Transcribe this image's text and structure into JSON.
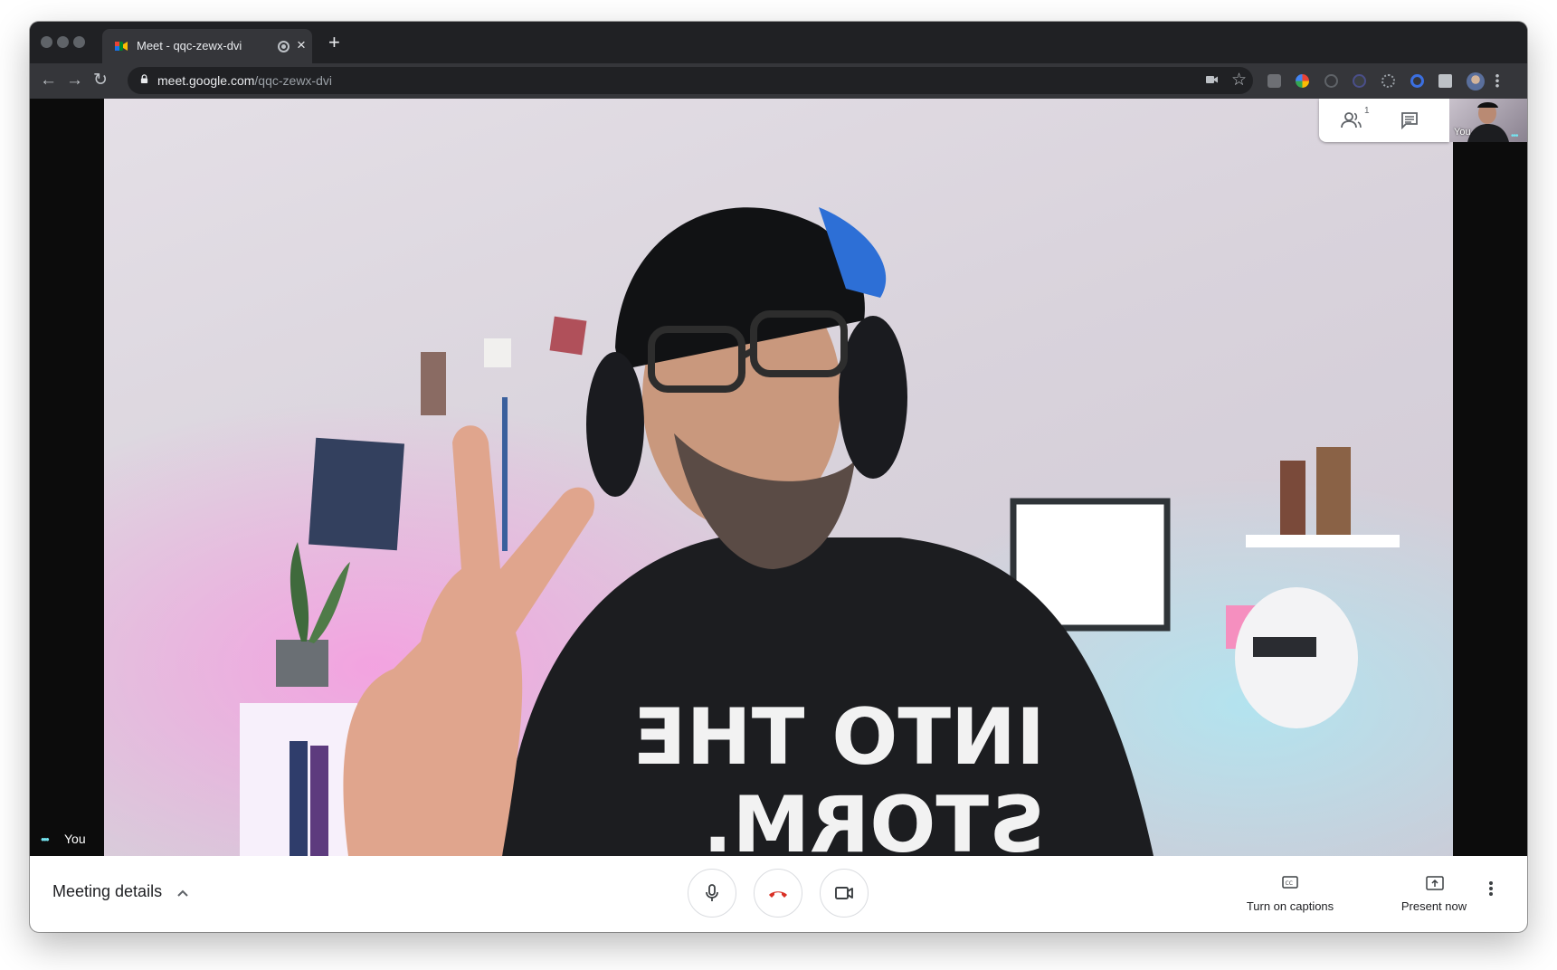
{
  "browser": {
    "tab_title": "Meet - qqc-zewx-dvi",
    "tab_close": "×",
    "new_tab": "+",
    "url_host": "meet.google.com",
    "url_path": "/qqc-zewx-dvi",
    "back": "←",
    "forward": "→",
    "reload": "↻",
    "star": "☆"
  },
  "meet": {
    "self_tile_label": "You",
    "participant_label": "You",
    "participant_badge": "1",
    "bottom": {
      "meeting_details": "Meeting details",
      "captions_label": "Turn on captions",
      "present_label": "Present now"
    }
  },
  "colors": {
    "accent": "#1a73e8",
    "end_call": "#d93025",
    "speaking_dots": "#74e2ee"
  },
  "icons": [
    "meet-favicon",
    "recording-dot-icon",
    "close-icon",
    "plus-icon",
    "back-arrow-icon",
    "forward-arrow-icon",
    "reload-icon",
    "lock-icon",
    "camera-icon",
    "star-icon",
    "people-icon",
    "chat-icon",
    "mic-icon",
    "hangup-icon",
    "video-camera-icon",
    "captions-icon",
    "present-icon",
    "more-vert-icon"
  ]
}
